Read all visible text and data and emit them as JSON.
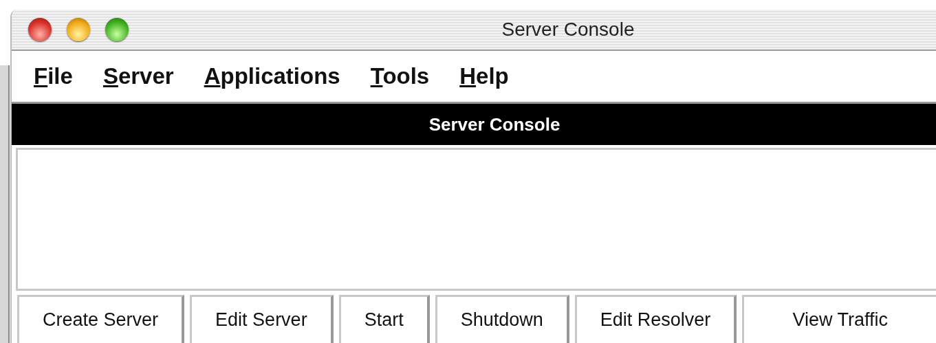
{
  "window": {
    "title": "Server Console"
  },
  "menu": [
    {
      "mnemonic": "F",
      "rest": "ile"
    },
    {
      "mnemonic": "S",
      "rest": "erver"
    },
    {
      "mnemonic": "A",
      "rest": "pplications"
    },
    {
      "mnemonic": "T",
      "rest": "ools"
    },
    {
      "mnemonic": "H",
      "rest": "elp"
    }
  ],
  "header": "Server Console",
  "buttons": [
    "Create Server",
    "Edit Server",
    "Start",
    "Shutdown",
    "Edit Resolver",
    "View Traffic"
  ]
}
